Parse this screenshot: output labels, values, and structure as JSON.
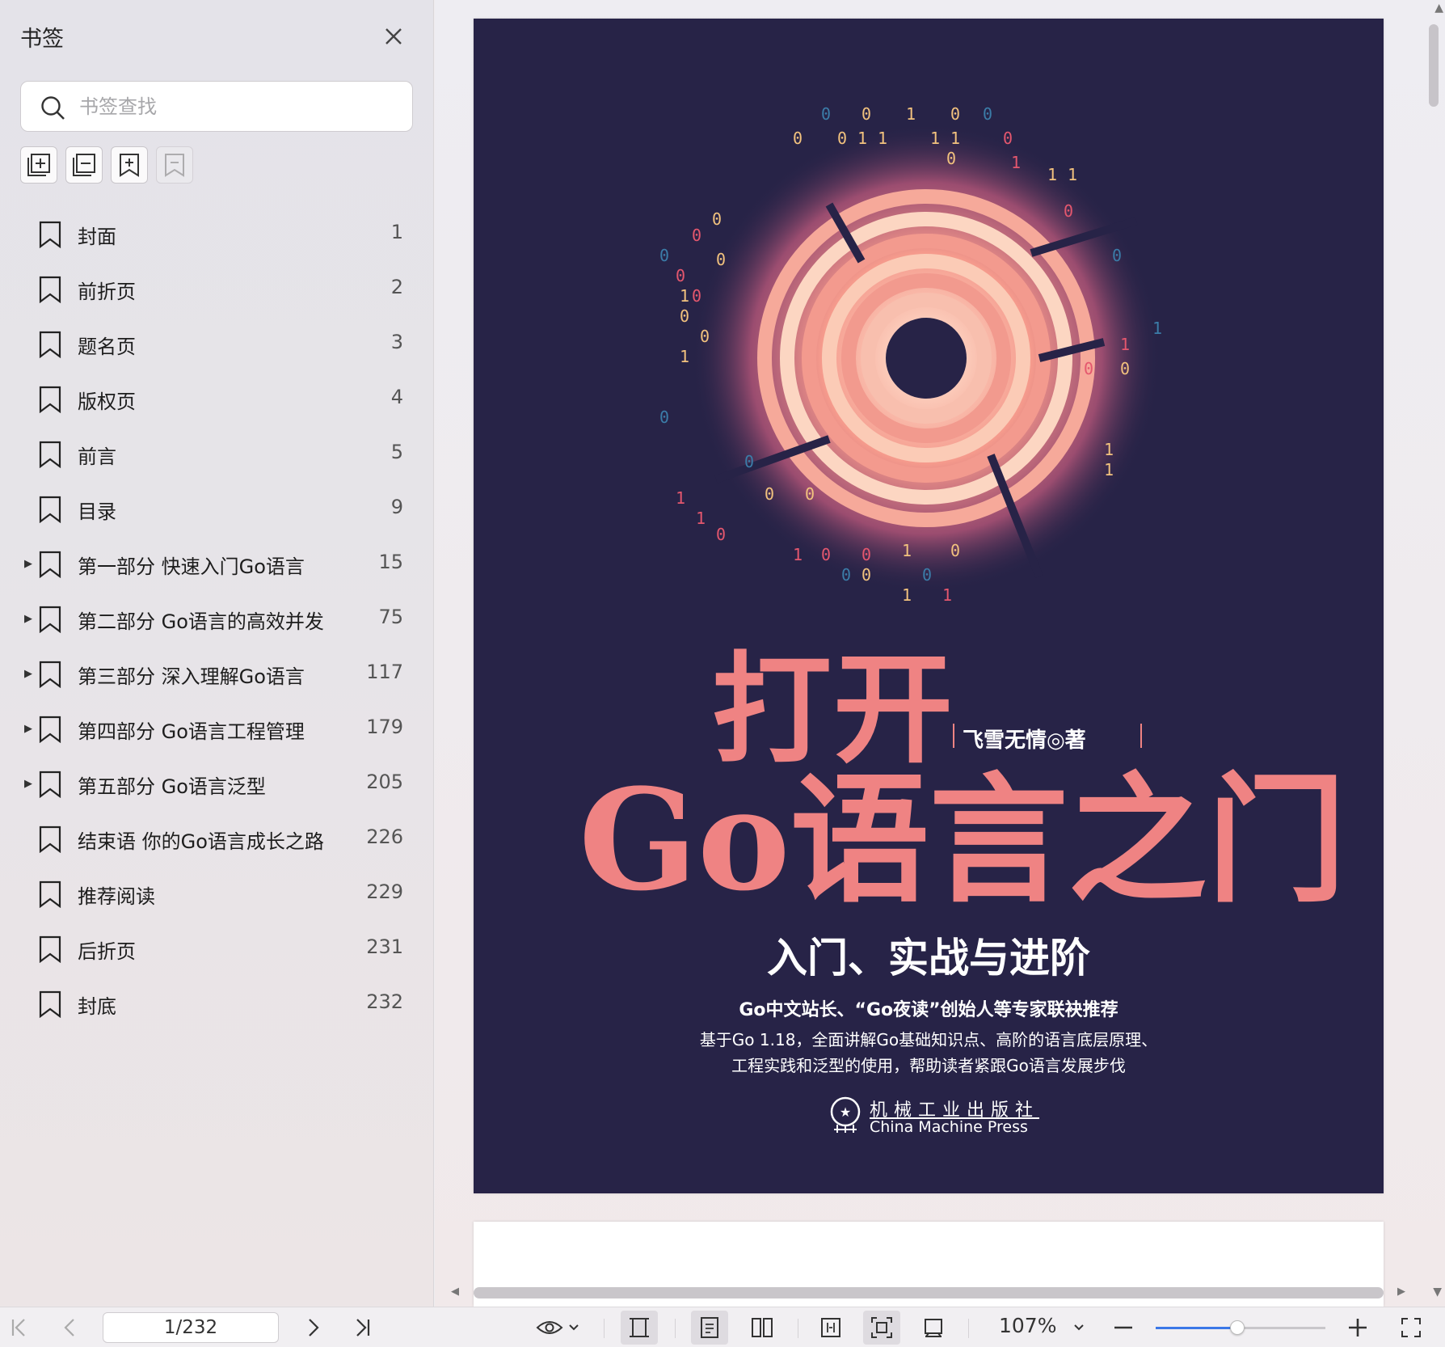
{
  "sidebar": {
    "title": "书签",
    "search_placeholder": "书签查找",
    "items": [
      {
        "label": "封面",
        "page": "1",
        "expandable": false
      },
      {
        "label": "前折页",
        "page": "2",
        "expandable": false
      },
      {
        "label": "题名页",
        "page": "3",
        "expandable": false
      },
      {
        "label": "版权页",
        "page": "4",
        "expandable": false
      },
      {
        "label": "前言",
        "page": "5",
        "expandable": false
      },
      {
        "label": "目录",
        "page": "9",
        "expandable": false
      },
      {
        "label": "第一部分 快速入门Go语言",
        "page": "15",
        "expandable": true
      },
      {
        "label": "第二部分 Go语言的高效并发",
        "page": "75",
        "expandable": true
      },
      {
        "label": "第三部分 深入理解Go语言",
        "page": "117",
        "expandable": true
      },
      {
        "label": "第四部分 Go语言工程管理",
        "page": "179",
        "expandable": true
      },
      {
        "label": "第五部分 Go语言泛型",
        "page": "205",
        "expandable": true
      },
      {
        "label": "结束语 你的Go语言成长之路",
        "page": "226",
        "expandable": false
      },
      {
        "label": "推荐阅读",
        "page": "229",
        "expandable": false
      },
      {
        "label": "后折页",
        "page": "231",
        "expandable": false
      },
      {
        "label": "封底",
        "page": "232",
        "expandable": false
      }
    ]
  },
  "cover": {
    "title_line1": "打开",
    "title_line2": "Go语言之门",
    "author": "飞雪无情◎著",
    "subtitle": "入门、实战与进阶",
    "tagline1": "Go中文站长、“Go夜读”创始人等专家联袂推荐",
    "tagline2": "基于Go 1.18，全面讲解Go基础知识点、高阶的语言底层原理、",
    "tagline3": "工程实践和泛型的使用，帮助读者紧跟Go语言发展步伐",
    "publisher_cn": "机械工业出版社",
    "publisher_en": "China Machine Press",
    "colors": {
      "background": "#272347",
      "accent": "#ef8383"
    }
  },
  "toolbar": {
    "page_indicator": "1/232",
    "zoom": "107%",
    "zoom_level": 0.48,
    "accent": "#3b78e7"
  }
}
